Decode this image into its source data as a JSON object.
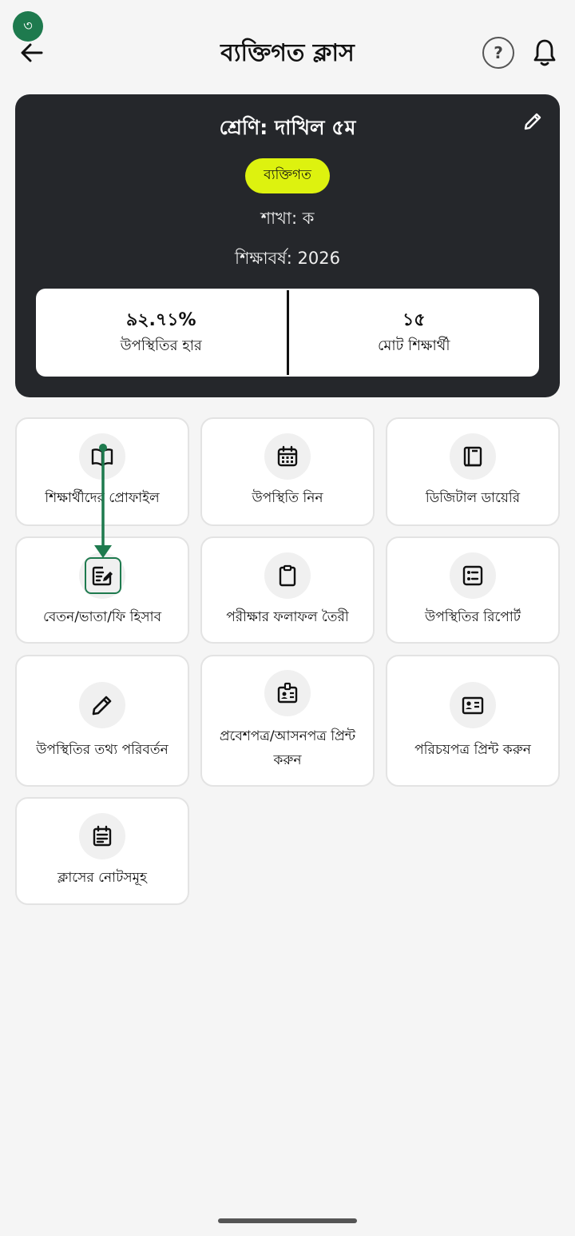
{
  "header": {
    "step_badge": "৩",
    "title": "ব্যক্তিগত ক্লাস",
    "help_symbol": "?",
    "back_icon": "arrow-left-icon",
    "bell_icon": "bell-icon"
  },
  "class_card": {
    "grade": "শ্রেণি: দাখিল ৫ম",
    "type_badge": "ব্যক্তিগত",
    "section": "শাখা: ক",
    "academic_year": "শিক্ষাবর্ষ: 2026",
    "stats": {
      "attendance_rate_value": "৯২.৭১%",
      "attendance_rate_label": "উপস্থিতির হার",
      "total_students_value": "১৫",
      "total_students_label": "মোট শিক্ষার্থী"
    },
    "colors": {
      "card_bg": "#25272b",
      "badge_bg": "#ddf20f"
    }
  },
  "tiles": [
    {
      "label": "শিক্ষার্থীদের প্রোফাইল",
      "icon": "book-open-icon"
    },
    {
      "label": "উপস্থিতি নিন",
      "icon": "calendar-icon"
    },
    {
      "label": "ডিজিটাল ডায়েরি",
      "icon": "diary-icon"
    },
    {
      "label": "বেতন/ভাতা/ফি হিসাব",
      "icon": "note-edit-icon"
    },
    {
      "label": "পরীক্ষার ফলাফল তৈরী",
      "icon": "clipboard-icon"
    },
    {
      "label": "উপস্থিতির রিপোর্ট",
      "icon": "list-report-icon"
    },
    {
      "label": "উপস্থিতির তথ্য পরিবর্তন",
      "icon": "pencil-icon"
    },
    {
      "label": "প্রবেশপত্র/আসনপত্র প্রিন্ট করুন",
      "icon": "id-badge-icon"
    },
    {
      "label": "পরিচয়পত্র প্রিন্ট করুন",
      "icon": "id-card-icon"
    },
    {
      "label": "ক্লাসের নোটসমূহ",
      "icon": "notes-icon"
    }
  ],
  "annotation": {
    "highlight_color": "#1e7a4e"
  }
}
